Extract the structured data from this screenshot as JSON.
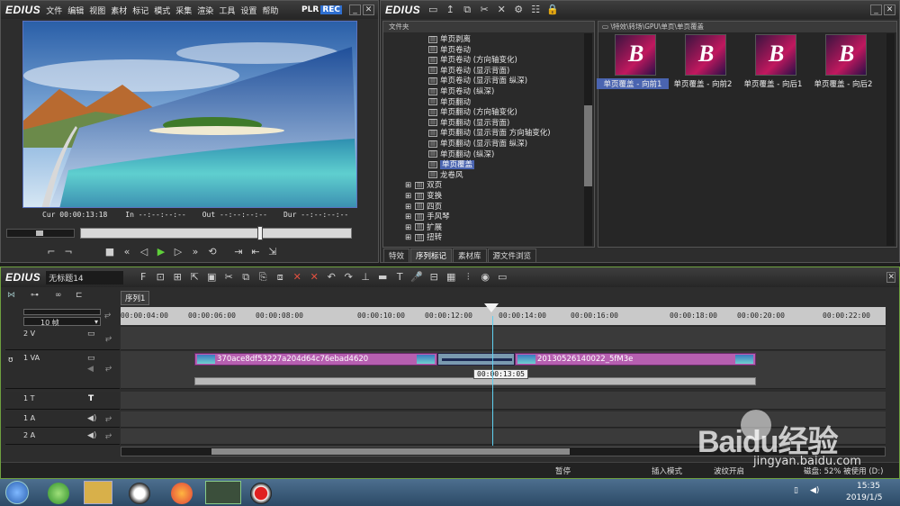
{
  "player": {
    "logo": "EDIUS",
    "menu": [
      "文件",
      "编辑",
      "视图",
      "素材",
      "标记",
      "模式",
      "采集",
      "渲染",
      "工具",
      "设置",
      "帮助"
    ],
    "mode_plr": "PLR",
    "mode_rec": "REC",
    "cur_label": "Cur",
    "cur_value": "00:00:13:18",
    "in_label": "In",
    "in_value": "--:--:--:--",
    "out_label": "Out",
    "out_value": "--:--:--:--",
    "dur_label": "Dur",
    "dur_value": "--:--:--:--"
  },
  "effects": {
    "logo": "EDIUS",
    "folder_header": "文件夹",
    "path": "\\特效\\转场\\GPU\\单页\\单页覆盖",
    "tree": [
      {
        "label": "单页剥离",
        "type": "leaf"
      },
      {
        "label": "单页卷动",
        "type": "leaf"
      },
      {
        "label": "单页卷动 (方向轴变化)",
        "type": "leaf"
      },
      {
        "label": "单页卷动 (显示背面)",
        "type": "leaf"
      },
      {
        "label": "单页卷动 (显示背面 纵深)",
        "type": "leaf"
      },
      {
        "label": "单页卷动 (纵深)",
        "type": "leaf"
      },
      {
        "label": "单页翻动",
        "type": "leaf"
      },
      {
        "label": "单页翻动 (方向轴变化)",
        "type": "leaf"
      },
      {
        "label": "单页翻动 (显示背面)",
        "type": "leaf"
      },
      {
        "label": "单页翻动 (显示背面 方向轴变化)",
        "type": "leaf"
      },
      {
        "label": "单页翻动 (显示背面 纵深)",
        "type": "leaf"
      },
      {
        "label": "单页翻动 (纵深)",
        "type": "leaf"
      },
      {
        "label": "单页覆盖",
        "type": "leaf",
        "selected": true
      },
      {
        "label": "龙卷风",
        "type": "leaf"
      },
      {
        "label": "双页",
        "type": "folder"
      },
      {
        "label": "变换",
        "type": "folder"
      },
      {
        "label": "四页",
        "type": "folder"
      },
      {
        "label": "手风琴",
        "type": "folder"
      },
      {
        "label": "扩展",
        "type": "folder"
      },
      {
        "label": "扭转",
        "type": "folder"
      }
    ],
    "clips": [
      "单页覆盖 - 向前1",
      "单页覆盖 - 向前2",
      "单页覆盖 - 向后1",
      "单页覆盖 - 向后2"
    ],
    "tabs": [
      "特效",
      "序列标记",
      "素材库",
      "源文件浏览"
    ]
  },
  "recorder": {
    "logo": "EDIUS",
    "project_name": "无标题14",
    "sequence_tab": "序列1",
    "zoom_label": "10 帧",
    "ruler": [
      "00:00:04:00",
      "00:00:06:00",
      "00:00:08:00",
      "00:00:10:00",
      "00:00:12:00",
      "00:00:14:00",
      "00:00:16:00",
      "00:00:18:00",
      "00:00:20:00",
      "00:00:22:00"
    ],
    "tracks": [
      {
        "name": "2 V"
      },
      {
        "name": "1 VA"
      },
      {
        "name": "1 T"
      },
      {
        "name": "1 A"
      },
      {
        "name": "2 A"
      }
    ],
    "clip_a": "370ace8df53227a204d64c76ebad4620",
    "clip_b": "20130526140022_5fM3e",
    "tooltip": "00:00:13:05",
    "status": [
      "暂停",
      "插入模式",
      "波纹开启",
      "磁盘: 52% 被使用 (D:)"
    ]
  },
  "taskbar": {
    "time": "15:35",
    "date": "2019/1/5"
  },
  "watermark": {
    "brand": "Baidu经验",
    "url": "jingyan.baidu.com"
  }
}
